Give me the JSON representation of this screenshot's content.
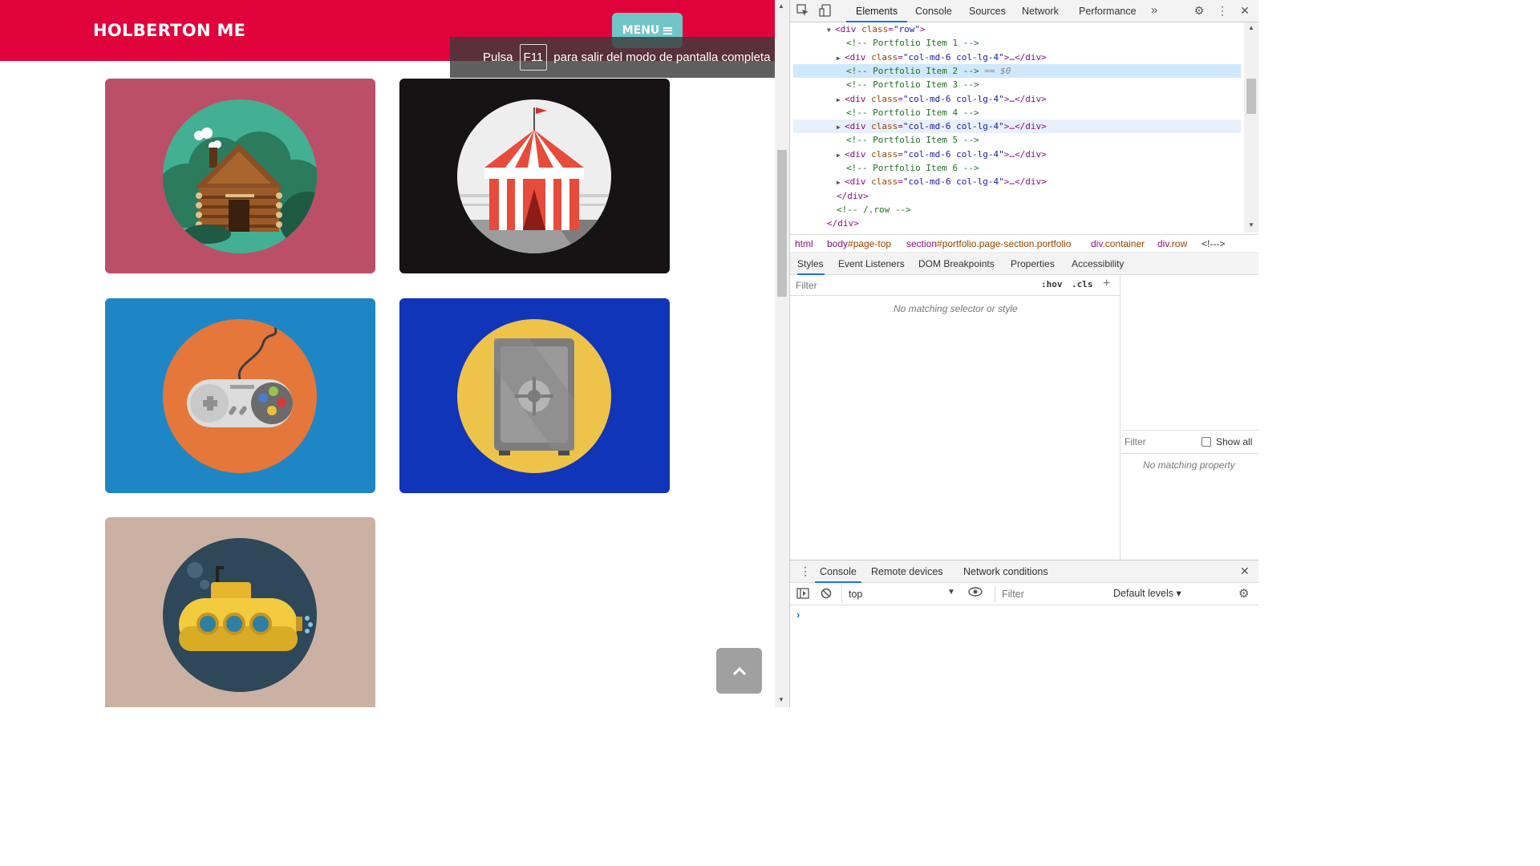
{
  "site": {
    "brand": "HOLBERTON ME",
    "menu_label": "MENU",
    "fullscreen_toast": {
      "before": "Pulsa",
      "key": "F11",
      "after": "para salir del modo de pantalla completa"
    },
    "tiles": [
      {
        "name": "cabin",
        "bg": "#bc4f68",
        "disc": "#43b093"
      },
      {
        "name": "circus-tent",
        "bg": "#151313",
        "disc": "#eeeeee"
      },
      {
        "name": "game-controller",
        "bg": "#1e86c4",
        "disc": "#e5773b"
      },
      {
        "name": "safe",
        "bg": "#1135b8",
        "disc": "#eec34a"
      },
      {
        "name": "submarine",
        "bg": "#cbb1a3",
        "disc": "#2e4759"
      }
    ]
  },
  "devtools": {
    "tabs": [
      "Elements",
      "Console",
      "Sources",
      "Network",
      "Performance"
    ],
    "active_tab": "Elements",
    "dom_lines": [
      {
        "indent": 0,
        "toggle": "▼",
        "tag": "div",
        "cls": "row",
        "close": "",
        "comment": ""
      },
      {
        "indent": 1,
        "toggle": "",
        "comment": "<!-- Portfolio Item 1 -->"
      },
      {
        "indent": 1,
        "toggle": "▶",
        "tag": "div",
        "cls": "col-md-6 col-lg-4",
        "close": "…</div>",
        "comment": ""
      },
      {
        "indent": 1,
        "toggle": "",
        "comment": "<!-- Portfolio Item 2 -->",
        "ref": " == $0",
        "selected": true
      },
      {
        "indent": 1,
        "toggle": "",
        "comment": "<!-- Portfolio Item 3 -->"
      },
      {
        "indent": 1,
        "toggle": "▶",
        "tag": "div",
        "cls": "col-md-6 col-lg-4",
        "close": "…</div>",
        "comment": ""
      },
      {
        "indent": 1,
        "toggle": "",
        "comment": "<!-- Portfolio Item 4 -->"
      },
      {
        "indent": 1,
        "toggle": "▶",
        "tag": "div",
        "cls": "col-md-6 col-lg-4",
        "close": "…</div>",
        "comment": "",
        "hover": true
      },
      {
        "indent": 1,
        "toggle": "",
        "comment": "<!-- Portfolio Item 5 -->"
      },
      {
        "indent": 1,
        "toggle": "▶",
        "tag": "div",
        "cls": "col-md-6 col-lg-4",
        "close": "…</div>",
        "comment": ""
      },
      {
        "indent": 1,
        "toggle": "",
        "comment": "<!-- Portfolio Item 6 -->"
      },
      {
        "indent": 1,
        "toggle": "▶",
        "tag": "div",
        "cls": "col-md-6 col-lg-4",
        "close": "…</div>",
        "comment": ""
      },
      {
        "indent": 0,
        "toggle": "",
        "endtag": "</div>"
      },
      {
        "indent": 0,
        "toggle": "",
        "comment": "<!-- /.row -->"
      },
      {
        "indent": -1,
        "toggle": "",
        "endtag": "</div>"
      }
    ],
    "breadcrumb": [
      {
        "tag": "html",
        "cls": ""
      },
      {
        "tag": "body",
        "cls": "#page-top"
      },
      {
        "tag": "section",
        "cls": "#portfolio.page-section.portfolio"
      },
      {
        "tag": "div",
        "cls": ".container"
      },
      {
        "tag": "div",
        "cls": ".row"
      },
      {
        "tag": "<!--->",
        "cls": ""
      }
    ],
    "side_tabs": [
      "Styles",
      "Event Listeners",
      "DOM Breakpoints",
      "Properties",
      "Accessibility"
    ],
    "styles_filter_placeholder": "Filter",
    "hov_label": ":hov",
    "cls_label": ".cls",
    "styles_empty": "No matching selector or style",
    "computed_filter_placeholder": "Filter",
    "show_all_label": "Show all",
    "computed_empty": "No matching property",
    "drawer_tabs": [
      "Console",
      "Remote devices",
      "Network conditions"
    ],
    "context_label": "top",
    "console_filter_placeholder": "Filter",
    "levels_label": "Default levels ▾"
  }
}
